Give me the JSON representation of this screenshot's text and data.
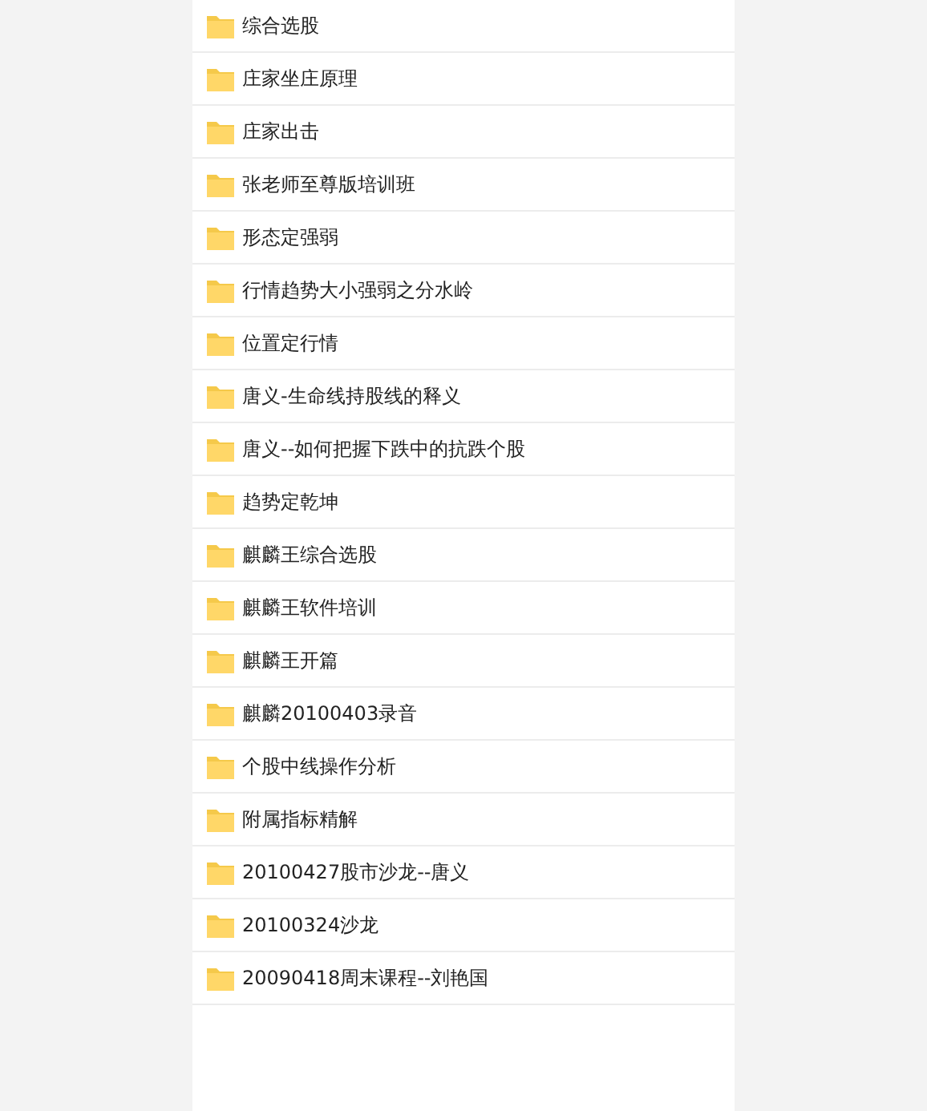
{
  "folders": [
    {
      "name": "综合选股"
    },
    {
      "name": "庄家坐庄原理"
    },
    {
      "name": "庄家出击"
    },
    {
      "name": "张老师至尊版培训班"
    },
    {
      "name": "形态定强弱"
    },
    {
      "name": "行情趋势大小强弱之分水岭"
    },
    {
      "name": "位置定行情"
    },
    {
      "name": "唐义-生命线持股线的释义"
    },
    {
      "name": "唐义--如何把握下跌中的抗跌个股"
    },
    {
      "name": "趋势定乾坤"
    },
    {
      "name": "麒麟王综合选股"
    },
    {
      "name": "麒麟王软件培训"
    },
    {
      "name": "麒麟王开篇"
    },
    {
      "name": "麒麟20100403录音"
    },
    {
      "name": "个股中线操作分析"
    },
    {
      "name": "附属指标精解"
    },
    {
      "name": "20100427股市沙龙--唐义"
    },
    {
      "name": "20100324沙龙"
    },
    {
      "name": "20090418周末课程--刘艳国"
    }
  ]
}
